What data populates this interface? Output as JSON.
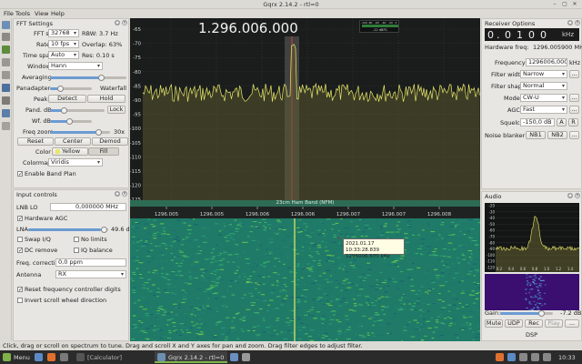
{
  "window": {
    "title": "Gqrx 2.14.2 - rtl=0"
  },
  "menu": [
    "File",
    "Tools",
    "View",
    "Help"
  ],
  "fft": {
    "title": "FFT Settings",
    "fft_size_label": "FFT size",
    "fft_size": "32768",
    "rbw": "RBW: 3.7 Hz",
    "rate_label": "Rate",
    "rate": "10 fps",
    "overlap": "Overlap: 63%",
    "timespan_label": "Time span",
    "timespan": "Auto",
    "res": "Res: 0.10 s",
    "window_label": "Window",
    "window": "Hann",
    "averaging_label": "Averaging",
    "panadapter_label": "Panadapter",
    "waterfall_label": "Waterfall",
    "peak_label": "Peak",
    "detect": "Detect",
    "hold": "Hold",
    "pand_db_label": "Pand. dB",
    "lock": "Lock",
    "wf_db_label": "Wf. dB",
    "freq_zoom_label": "Freq zoom",
    "zoom_value": "30x",
    "reset": "Reset",
    "center": "Center",
    "demod": "Demod",
    "color_label": "Color",
    "color_value": "Yellow",
    "fill": "Fill",
    "colormap_label": "Colormap",
    "colormap": "Viridis",
    "band_plan": "Enable Band Plan"
  },
  "input": {
    "title": "Input controls",
    "lnb_label": "LNB LO",
    "lnb_value": "0,000000 MHz",
    "hw_agc": "Hardware AGC",
    "lna_label": "LNA",
    "lna_value": "49.6 dB",
    "swap_iq": "Swap I/Q",
    "no_limits": "No limits",
    "dc_remove": "DC remove",
    "iq_balance": "IQ balance",
    "freq_corr_label": "Freq. correction",
    "freq_corr": "0,0 ppm",
    "antenna_label": "Antenna",
    "antenna": "RX",
    "reset_freq_digits": "Reset frequency controller digits",
    "invert_scroll": "Invert scroll wheel direction"
  },
  "spectrum": {
    "frequency": "1.296.006.000",
    "db_ticks": [
      "-65",
      "-70",
      "-75",
      "-80",
      "-85",
      "-90",
      "-95",
      "-100",
      "-105",
      "-110",
      "-115",
      "-120",
      "-125"
    ],
    "meter_ticks": [
      "-100",
      "-80",
      "-60",
      "-40",
      "-20",
      "0"
    ],
    "meter_value": "-12 dBFS",
    "band_label": "23cm Ham Band (NFM)",
    "freq_ticks": [
      "1296.005",
      "1296.005",
      "1296.006",
      "1296.006",
      "1296.007",
      "1296.007",
      "1296.008"
    ],
    "tooltip_time": "2021.01.17 10:33:28.839",
    "tooltip_freq": "1296006.500 kHz",
    "trace_color": "#e8e86a"
  },
  "receiver": {
    "title": "Receiver Options",
    "offset_digits": [
      "0",
      ".",
      "0",
      "1",
      "0",
      "0"
    ],
    "offset_unit": "kHz",
    "hw_freq_label": "Hardware freq:",
    "hw_freq": "1296.005900 MHz",
    "frequency_label": "Frequency",
    "frequency": "1296006,000",
    "freq_unit": "kHz",
    "filter_width_label": "Filter width",
    "filter_width": "Narrow",
    "filter_shape_label": "Filter shape",
    "filter_shape": "Normal",
    "mode_label": "Mode",
    "mode": "CW-U",
    "agc_label": "AGC",
    "agc": "Fast",
    "squelch_label": "Squelch",
    "squelch": "-150,0 dB",
    "a": "A",
    "r": "R",
    "nb_label": "Noise blanker",
    "nb1": "NB1",
    "nb2": "NB2",
    "more": "..."
  },
  "audio": {
    "title": "Audio",
    "yticks": [
      "-20",
      "-30",
      "-40",
      "-50",
      "-60",
      "-70",
      "-80",
      "-90",
      "-100",
      "-110",
      "-120"
    ],
    "xticks": [
      "0.2",
      "0.4",
      "0.6",
      "0.8",
      "1.0",
      "1.2",
      "1.4"
    ],
    "gain_label": "Gain:",
    "gain_value": "-7.2 dB",
    "mute": "Mute",
    "udp": "UDP",
    "rec": "Rec",
    "play": "Play",
    "more": "...",
    "dsp": "DSP"
  },
  "status": {
    "text": "Click, drag or scroll on spectrum to tune. Drag and scroll X and Y axes for pan and zoom. Drag filter edges to adjust filter."
  },
  "taskbar": {
    "menu": "Menu",
    "calculator": "[Calculator]",
    "gqrx": "Gqrx 2.14.2 - rtl=0",
    "clock": "10:33"
  }
}
